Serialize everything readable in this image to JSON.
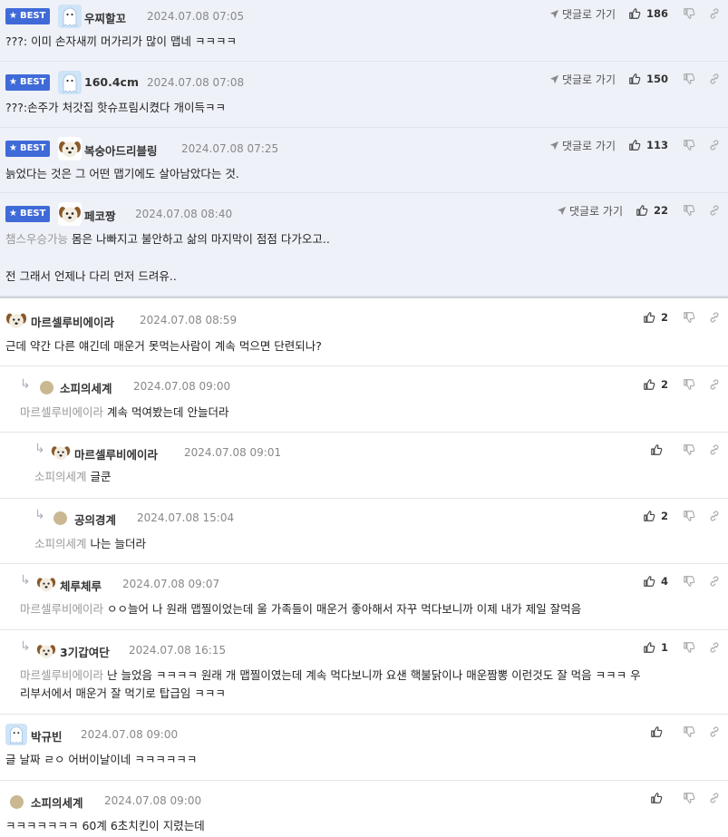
{
  "labels": {
    "best": "BEST",
    "goto": "댓글로 가기"
  },
  "colors": {
    "best_badge": "#3f6ad8",
    "best_bg": "#eef1f8",
    "mention": "#999999"
  },
  "best_comments": [
    {
      "nick": "우찌할꼬",
      "date": "2024.07.08 07:05",
      "likes": "186",
      "body": "???: 이미 손자새끼 머가리가 많이 맵네 ㅋㅋㅋㅋ",
      "mention": ""
    },
    {
      "nick": "160.4cm",
      "date": "2024.07.08 07:08",
      "likes": "150",
      "body": "???:손주가 처갓집 핫슈프림시켰다 개이득ㅋㅋ",
      "mention": ""
    },
    {
      "nick": "복숭아드리블링",
      "date": "2024.07.08 07:25",
      "likes": "113",
      "body": "늙었다는 것은 그 어떤 맵기에도 살아남았다는 것.",
      "mention": ""
    },
    {
      "nick": "페코짱",
      "date": "2024.07.08 08:40",
      "likes": "22",
      "mention": "챔스우승가능",
      "body": "몸은 나빠지고 불안하고 삶의 마지막이 점점 다가오고..",
      "body2": "전 그래서 언제나 다리 먼저 드려유.."
    }
  ],
  "comments": [
    {
      "nick": "마르셀루비에이라",
      "date": "2024.07.08 08:59",
      "likes": "2",
      "mention": "",
      "body": "근데 약간 다른 얘긴데 매운거 못먹는사람이 계속 먹으면 단련되나?"
    },
    {
      "nick": "소피의세계",
      "date": "2024.07.08 09:00",
      "likes": "2",
      "mention": "마르셀루비에이라",
      "body": "계속 먹여봤는데 안늘더라"
    },
    {
      "nick": "마르셀루비에이라",
      "date": "2024.07.08 09:01",
      "likes": "",
      "mention": "소피의세계",
      "body": "글쿤"
    },
    {
      "nick": "공의경계",
      "date": "2024.07.08 15:04",
      "likes": "2",
      "mention": "소피의세계",
      "body": "나는 늘더라"
    },
    {
      "nick": "체루체루",
      "date": "2024.07.08 09:07",
      "likes": "4",
      "mention": "마르셀루비에이라",
      "body": "ㅇㅇ늘어 나 원래 맵찔이었는데 울 가족들이 매운거 좋아해서 자꾸 먹다보니까 이제 내가 제일 잘먹음"
    },
    {
      "nick": "3기갑여단",
      "date": "2024.07.08 16:15",
      "likes": "1",
      "mention": "마르셀루비에이라",
      "body": "난 늘었음 ㅋㅋㅋㅋ 원래 개 맵찔이였는데 계속 먹다보니까 요샌 핵불닭이나 매운짬뽕 이런것도 잘 먹음 ㅋㅋㅋ 우",
      "body2": "리부서에서 매운거 잘 먹기로 탑급임 ㅋㅋㅋ"
    },
    {
      "nick": "박규빈",
      "date": "2024.07.08 09:00",
      "likes": "",
      "mention": "",
      "body": "글 날짜 ㄹㅇ 어버이날이네 ㅋㅋㅋㅋㅋㅋ"
    },
    {
      "nick": "소피의세계",
      "date": "2024.07.08 09:00",
      "likes": "",
      "mention": "",
      "body": "ㅋㅋㅋㅋㅋㅋㅋ 60계 6초치킨이 지렸는데"
    }
  ]
}
